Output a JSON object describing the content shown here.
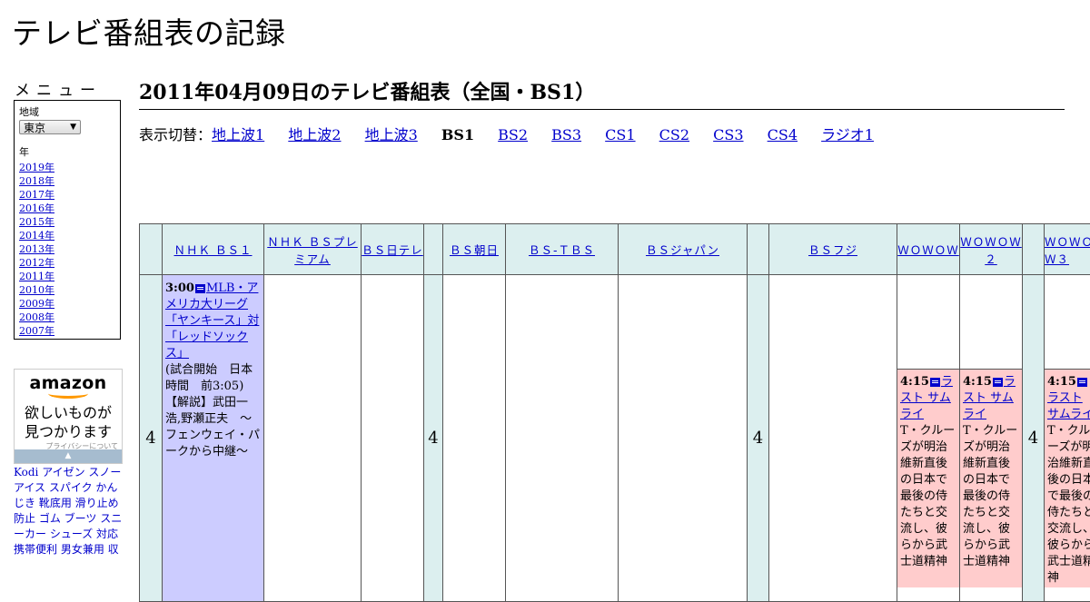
{
  "site_title": "テレビ番組表の記録",
  "page_title": "2011年04月09日のテレビ番組表（全国・BS1）",
  "menu": {
    "heading": "メニュー",
    "region_label": "地域",
    "region_value": "東京",
    "year_label": "年",
    "years": [
      "2019年",
      "2018年",
      "2017年",
      "2016年",
      "2015年",
      "2014年",
      "2013年",
      "2012年",
      "2011年",
      "2010年",
      "2009年",
      "2008年",
      "2007年"
    ]
  },
  "ad": {
    "brand": "amazon",
    "copy_line1": "欲しいものが",
    "copy_line2": "見つかります",
    "privacy": "プライバシーについて"
  },
  "keyword_links": "Kodi アイゼン スノーアイス スパイク かんじき 靴底用 滑り止め 防止 ゴム ブーツ スニーカー シューズ 対応 携帯便利 男女兼用 収",
  "switcher": {
    "label": "表示切替：",
    "items": [
      {
        "label": "地上波1",
        "current": false
      },
      {
        "label": "地上波2",
        "current": false
      },
      {
        "label": "地上波3",
        "current": false
      },
      {
        "label": "BS1",
        "current": true
      },
      {
        "label": "BS2",
        "current": false
      },
      {
        "label": "BS3",
        "current": false
      },
      {
        "label": "CS1",
        "current": false
      },
      {
        "label": "CS2",
        "current": false
      },
      {
        "label": "CS3",
        "current": false
      },
      {
        "label": "CS4",
        "current": false
      },
      {
        "label": "ラジオ1",
        "current": false
      }
    ]
  },
  "schedule": {
    "hour": "4",
    "channels": {
      "nhk_bs1": "ＮＨＫ ＢＳ１",
      "nhk_bs_premium": "ＮＨＫ ＢＳプレミアム",
      "bs_nittele": "ＢＳ日テレ",
      "bs_asahi": "ＢＳ朝日",
      "bs_tbs": "ＢＳ-ＴＢＳ",
      "bs_japan": "ＢＳジャパン",
      "bs_fuji": "ＢＳフジ",
      "wowow": "ＷＯＷＯＷ",
      "wowow2": "ＷＯＷＯＷ２",
      "wowow3": "ＷＯＷＯＷ３"
    },
    "mlb": {
      "time": "3:00",
      "title": "MLB・アメリカ大リーグ「ヤンキース」対「レッドソックス」",
      "desc": "(試合開始　日本時間　前3:05) 【解説】武田一浩,野瀬正夫　～フェンウェイ・パークから中継～"
    },
    "last_samurai": {
      "time": "4:15",
      "title": "ラスト サムライ",
      "desc": "T・クルーズが明治維新直後の日本で最後の侍たちと交流し、彼らから武士道精神"
    }
  }
}
